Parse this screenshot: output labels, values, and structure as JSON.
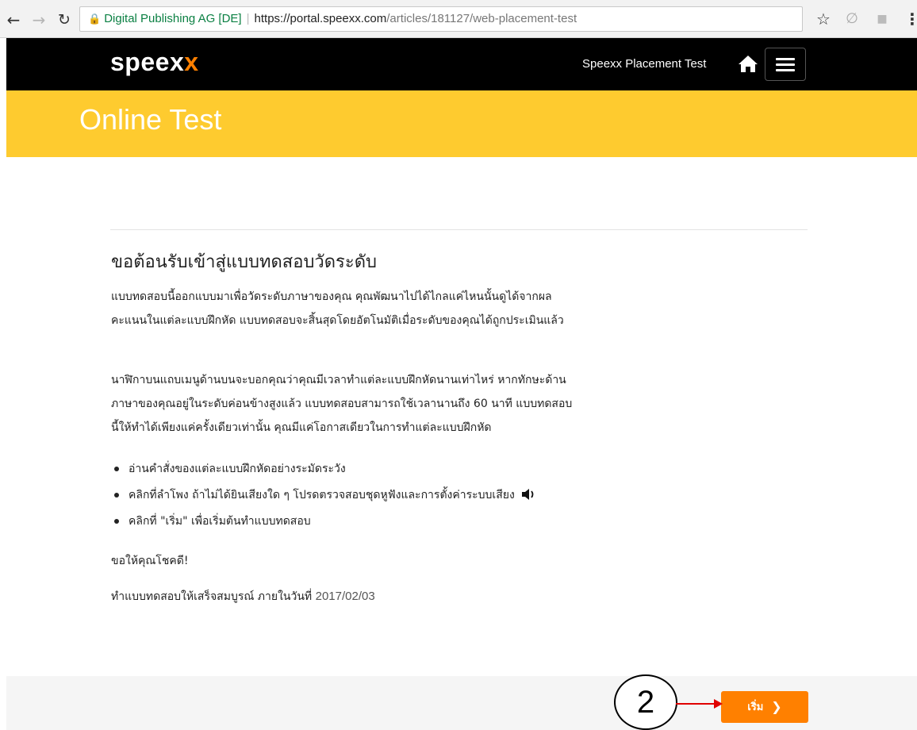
{
  "browser": {
    "org_label": "Digital Publishing AG [DE]",
    "url_host": "https://portal.speexx.com",
    "url_path": "/articles/181127/web-placement-test"
  },
  "header": {
    "logo_main": "speex",
    "logo_accent": "x",
    "title": "Speexx Placement Test"
  },
  "banner": {
    "title": "Online Test"
  },
  "content": {
    "welcome_heading": "ขอต้อนรับเข้าสู่แบบทดสอบวัดระดับ",
    "paragraph1_line1": "แบบทดสอบนี้ออกแบบมาเพื่อวัดระดับภาษาของคุณ คุณพัฒนาไปได้ไกลแค่ไหนนั้นดูได้จากผล",
    "paragraph1_line2": "คะแนนในแต่ละแบบฝึกหัด แบบทดสอบจะสิ้นสุดโดยอัตโนมัติเมื่อระดับของคุณได้ถูกประเมินแล้ว",
    "paragraph2_line1": "นาฬิกาบนแถบเมนูด้านบนจะบอกคุณว่าคุณมีเวลาทำแต่ละแบบฝึกหัดนานเท่าไหร่ หากทักษะด้าน",
    "paragraph2_line2": "ภาษาของคุณอยู่ในระดับค่อนข้างสูงแล้ว แบบทดสอบสามารถใช้เวลานานถึง 60 นาที แบบทดสอบ",
    "paragraph2_line3": "นี้ให้ทำได้เพียงแค่ครั้งเดียวเท่านั้น คุณมีแค่โอกาสเดียวในการทำแต่ละแบบฝึกหัด",
    "bullets": [
      "อ่านคำสั่งของแต่ละแบบฝึกหัดอย่างระมัดระวัง",
      "คลิกที่ลำโพง ถ้าไม่ได้ยินเสียงใด ๆ โปรดตรวจสอบชุดหูฟังและการตั้งค่าระบบเสียง",
      "คลิกที่ \"เริ่ม\" เพื่อเริ่มต้นทำแบบทดสอบ"
    ],
    "good_luck": "ขอให้คุณโชคดี!",
    "deadline_prefix": "ทำแบบทดสอบให้เสร็จสมบูรณ์ ภายในวันที่",
    "deadline_date": "2017/02/03"
  },
  "footer": {
    "start_label": "เริ่ม"
  },
  "annotation": {
    "step_number": "2"
  },
  "colors": {
    "banner": "#fecb2f",
    "accent": "#ff8000",
    "header_bg": "#000000"
  },
  "icons": [
    "back-icon",
    "forward-icon",
    "reload-icon",
    "lock-icon",
    "star-icon",
    "home-icon",
    "menu-icon",
    "speaker-icon",
    "chevron-right-icon"
  ]
}
